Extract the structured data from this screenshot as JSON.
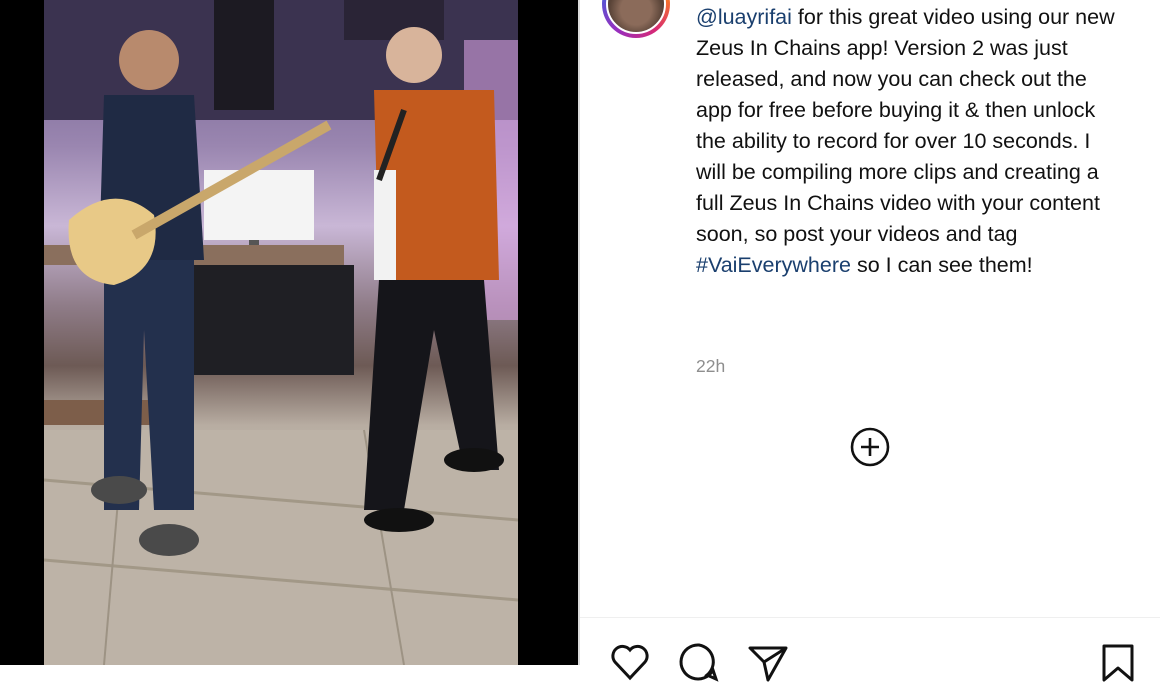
{
  "post": {
    "caption_before": "for this great video using our new Zeus In Chains app! Version 2 was just released, and now you can check out the app for free before buying it & then unlock the ability to record for over 10 seconds. I will be compiling more clips and creating a full Zeus In Chains video with your content soon, so post your videos and tag",
    "mention": "@luayrifai",
    "hashtag": "#VaiEverywhere",
    "caption_after": "so I can see them!",
    "timestamp": "22h"
  },
  "icons": {
    "add": "plus-circle-icon",
    "like": "heart-icon",
    "comment": "comment-icon",
    "share": "send-icon",
    "save": "bookmark-icon"
  },
  "colors": {
    "link": "#1a3f6e",
    "text": "#111111",
    "muted": "#8e8e8e"
  }
}
